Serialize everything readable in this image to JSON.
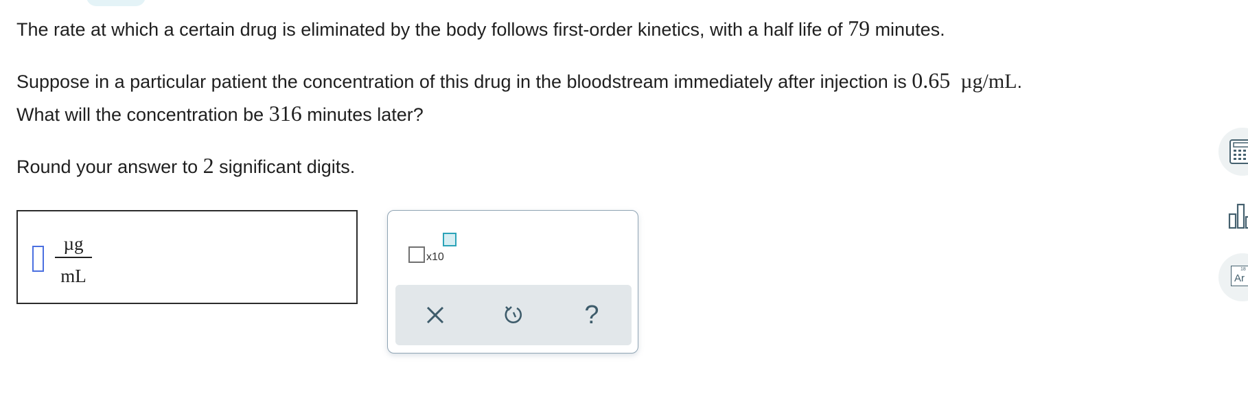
{
  "question": {
    "line1": {
      "before": "The rate at which a certain drug is eliminated by the body follows first-order kinetics, with a half life of ",
      "half_life": "79",
      "after": " minutes."
    },
    "line2": {
      "before": "Suppose in a particular patient the concentration of this drug in the bloodstream immediately after injection is ",
      "concentration": "0.65",
      "unit": "µg/mL",
      "after": "."
    },
    "line3": {
      "before": "What will the concentration be ",
      "time": "316",
      "after": " minutes later?"
    },
    "line4": {
      "before": "Round your answer to ",
      "digits": "2",
      "after": " significant digits."
    }
  },
  "answer": {
    "value": "",
    "unit_numerator": "µg",
    "unit_denominator": "mL"
  },
  "keypad": {
    "sci_notation_label": "x10"
  },
  "side_tools": {
    "periodic_number": "18",
    "periodic_symbol": "Ar"
  },
  "colors": {
    "accent": "#2aa3b8",
    "cursor": "#4a6fe0",
    "icon": "#3e5c6b",
    "action_bar": "#e2e7ea"
  },
  "icons": [
    "calculator-icon",
    "bar-chart-icon",
    "periodic-table-icon",
    "close-icon",
    "undo-icon",
    "help-icon"
  ]
}
